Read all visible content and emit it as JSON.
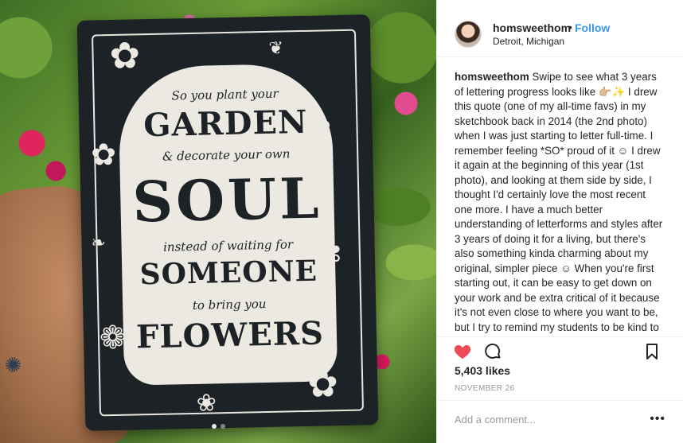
{
  "post": {
    "image": {
      "quote_lines": [
        "So you plant your",
        "GARDEN",
        "& decorate your own",
        "SOUL",
        "instead of waiting for",
        "SOMEONE",
        "to bring you",
        "FLOWERS"
      ],
      "carousel_total": 2,
      "carousel_active": 1
    },
    "header": {
      "username": "homsweethom",
      "separator": "•",
      "follow_label": "Follow",
      "location": "Detroit, Michigan"
    },
    "caption": {
      "username": "homsweethom",
      "text": "Swipe to see what 3 years of lettering progress looks like 👉🏼✨ I drew this quote (one of my all-time favs) in my sketchbook back in 2014 (the 2nd photo) when I was just starting to letter full-time. I remember feeling *SO* proud of it ☺ I drew it again at the beginning of this year (1st photo), and looking at them side by side, I thought I'd certainly love the most recent one more. I have a much better understanding of letterforms and styles after 3 years of doing it for a living, but there's also something kinda charming about my original, simpler piece ☺ When you're first starting out, it can be easy to get down on your work and be extra critical of it because it's not even close to where you want to be, but I try to remind my students to be kind to themselves and their art babies because here's what I've learned: your skills and style will evolve"
    },
    "actions": {
      "like_icon": "heart-icon",
      "comment_icon": "comment-icon",
      "save_icon": "bookmark-icon",
      "liked": true,
      "like_color": "#ed4956"
    },
    "likes_label": "5,403 likes",
    "date_label": "NOVEMBER 26",
    "comment_box": {
      "placeholder": "Add a comment...",
      "value": "",
      "more_label": "•••"
    }
  }
}
